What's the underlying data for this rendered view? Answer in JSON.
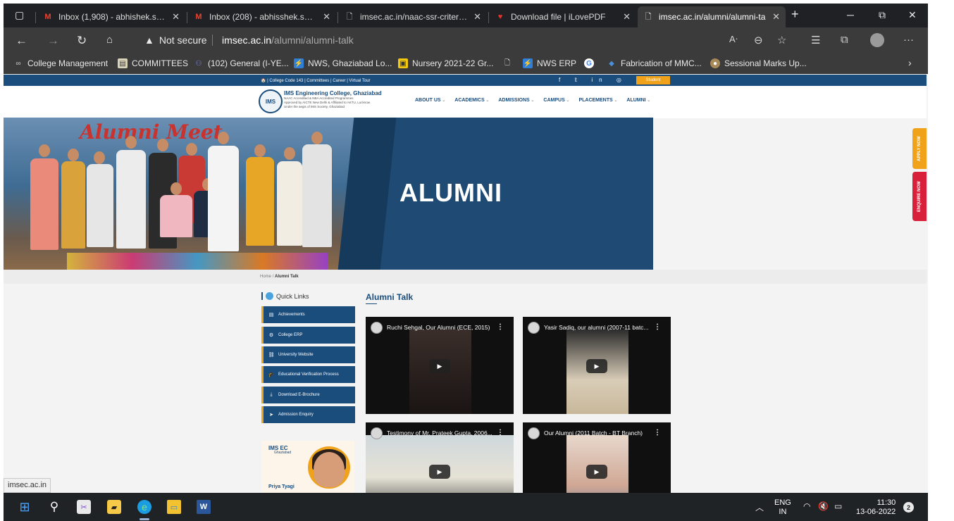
{
  "browser": {
    "tabs": [
      {
        "title": "Inbox (1,908) - abhishek.saxen",
        "icon": "gmail-icon"
      },
      {
        "title": "Inbox (208) - abhisshek.s@gr",
        "icon": "gmail-icon"
      },
      {
        "title": "imsec.ac.in/naac-ssr-criterion-",
        "icon": "page-icon"
      },
      {
        "title": "Download file | iLovePDF",
        "icon": "ilovepdf-icon"
      },
      {
        "title": "imsec.ac.in/alumni/alumni-ta",
        "icon": "page-icon"
      }
    ],
    "close_glyph": "✕",
    "new_tab_glyph": "+",
    "security_label": "Not secure",
    "url_host": "imsec.ac.in",
    "url_path": "/alumni/alumni-talk",
    "favorites": [
      {
        "label": "College Management"
      },
      {
        "label": "COMMITTEES"
      },
      {
        "label": "(102) General (I-YE..."
      },
      {
        "label": "NWS, Ghaziabad Lo..."
      },
      {
        "label": "Nursery 2021-22 Gr..."
      },
      {
        "label": "NWS ERP"
      },
      {
        "label": ""
      },
      {
        "label": "Fabrication of MMC..."
      },
      {
        "label": "Sessional Marks Up..."
      }
    ],
    "status_url": "imsec.ac.in"
  },
  "site": {
    "topstrip_links": "🏠 | College Code 143 | Committees | Career | Virtual Tour",
    "student_label": "Student",
    "college_name": "IMS Engineering College, Ghaziabad",
    "college_sub1": "NAAC Accredited & NBA Accredited Programmes",
    "college_sub2": "Approved by AICTE New Delhi & Affiliated to AKTU, Lucknow",
    "college_sub3": "Under the aegis of IMS Society, Ghaziabad",
    "seal_text": "IMS",
    "nav": [
      "ABOUT US",
      "ACADEMICS",
      "ADMISSIONS",
      "CAMPUS",
      "PLACEMENTS",
      "ALUMNI"
    ],
    "hero_banner": "Alumni Meet",
    "hero_title": "ALUMNI",
    "apply_now": "APPLY NOW",
    "enquire_now": "ENQUIRE NOW",
    "breadcrumb_home": "Home",
    "breadcrumb_current": "Alumni Talk",
    "quick_links_title": "Quick Links",
    "quick_links": [
      {
        "label": "Achievements",
        "icon": "document-icon"
      },
      {
        "label": "College ERP",
        "icon": "gear-icon"
      },
      {
        "label": "University Website",
        "icon": "link-icon"
      },
      {
        "label": "Educational Verification Process",
        "icon": "graduation-cap-icon"
      },
      {
        "label": "Download E-Brochure",
        "icon": "download-icon"
      },
      {
        "label": "Admission Enquiry",
        "icon": "send-icon"
      }
    ],
    "promo_logo": "IMS EC",
    "promo_logo_sub": "Ghaziabad",
    "promo_name": "Priya Tyagi",
    "section_title": "Alumni Talk",
    "videos": [
      {
        "title": "Ruchi Sehgal, Our Alumni (ECE, 2015)"
      },
      {
        "title": "Yasir Sadiq, our alumni (2007-11 batc..."
      },
      {
        "title": "Testimony of Mr. Prateek Gupta, 2006..."
      },
      {
        "title": "Our Alumni (2011 Batch - BT Branch)"
      }
    ]
  },
  "taskbar": {
    "lang_top": "ENG",
    "lang_bottom": "IN",
    "time": "11:30",
    "date": "13-06-2022",
    "notifications": "2"
  },
  "colors": {
    "brand_blue": "#1a4c7c",
    "accent_orange": "#f0a21a",
    "enquire_red": "#d8203a"
  }
}
